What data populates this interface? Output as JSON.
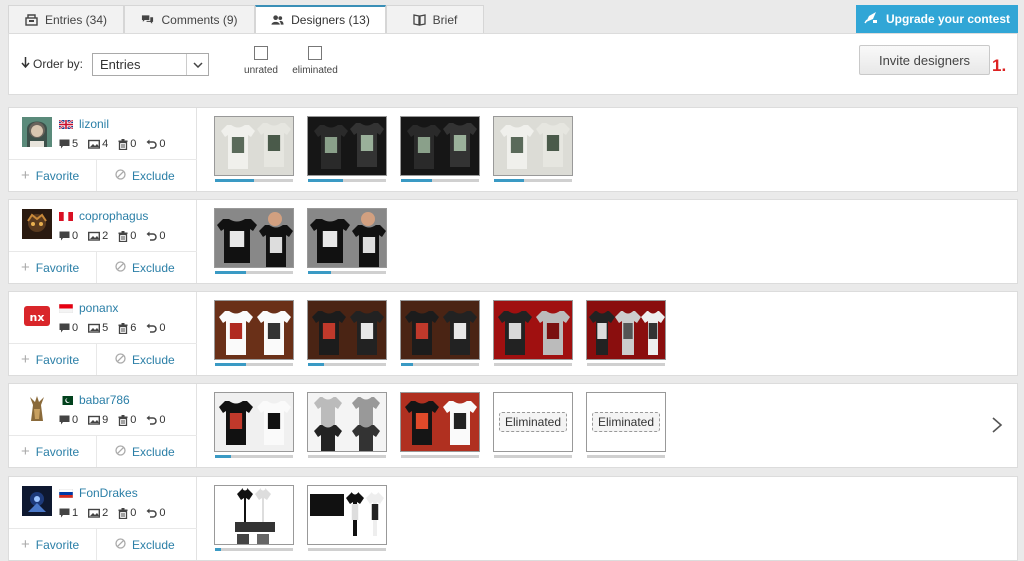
{
  "tabs": [
    {
      "label": "Entries (34)",
      "icon": "entries-icon",
      "active": false
    },
    {
      "label": "Comments (9)",
      "icon": "comments-icon",
      "active": false
    },
    {
      "label": "Designers (13)",
      "icon": "designers-icon",
      "active": true
    },
    {
      "label": "Brief",
      "icon": "brief-icon",
      "active": false
    }
  ],
  "upgrade": {
    "label": "Upgrade your contest",
    "icon": "rocket-icon"
  },
  "filters": {
    "order_label": "Order by:",
    "order_value": "Entries",
    "checkboxes": [
      {
        "label": "unrated"
      },
      {
        "label": "eliminated"
      }
    ],
    "invite_label": "Invite designers",
    "step_mark": "1."
  },
  "actions": {
    "favorite": "Favorite",
    "exclude": "Exclude",
    "eliminated": "Eliminated"
  },
  "designers": [
    {
      "name": "lizonil",
      "flag": "uk-flag",
      "stats": {
        "comments": "5",
        "entries": "4",
        "deleted": "0",
        "withdrawn": "0"
      },
      "entries": [
        {
          "style": "light",
          "progress": 0.5
        },
        {
          "style": "dark",
          "progress": 0.45
        },
        {
          "style": "dark",
          "progress": 0.4
        },
        {
          "style": "light",
          "progress": 0.38
        }
      ]
    },
    {
      "name": "coprophagus",
      "flag": "peru-flag",
      "stats": {
        "comments": "0",
        "entries": "2",
        "deleted": "0",
        "withdrawn": "0"
      },
      "entries": [
        {
          "style": "black-model",
          "progress": 0.4
        },
        {
          "style": "black-model",
          "progress": 0.3
        }
      ]
    },
    {
      "name": "ponanx",
      "flag": "indonesia-flag",
      "stats": {
        "comments": "0",
        "entries": "5",
        "deleted": "6",
        "withdrawn": "0"
      },
      "entries": [
        {
          "style": "brown-white",
          "progress": 0.4
        },
        {
          "style": "brown-dark",
          "progress": 0.2
        },
        {
          "style": "brown-dark",
          "progress": 0.15
        },
        {
          "style": "red",
          "progress": 0.0
        },
        {
          "style": "red-dark",
          "progress": 0.0
        }
      ]
    },
    {
      "name": "babar786",
      "flag": "pakistan-flag",
      "stats": {
        "comments": "0",
        "entries": "9",
        "deleted": "0",
        "withdrawn": "0"
      },
      "entries": [
        {
          "style": "black-white",
          "progress": 0.2,
          "eliminated": false
        },
        {
          "style": "grey-set",
          "progress": 0.0,
          "eliminated": false
        },
        {
          "style": "red-white",
          "progress": 0.0,
          "eliminated": false
        },
        {
          "style": "blank",
          "progress": 0.0,
          "eliminated": true
        },
        {
          "style": "blank",
          "progress": 0.0,
          "eliminated": true
        }
      ]
    },
    {
      "name": "FonDrakes",
      "flag": "russia-flag",
      "stats": {
        "comments": "1",
        "entries": "2",
        "deleted": "0",
        "withdrawn": "0"
      },
      "entries": [
        {
          "style": "sheet",
          "progress": 0.08
        },
        {
          "style": "sheet2",
          "progress": 0.0
        }
      ]
    }
  ]
}
